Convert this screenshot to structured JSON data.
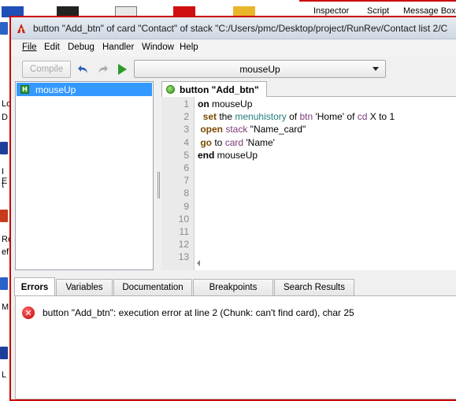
{
  "desktop": {
    "inspector_label": "Inspector",
    "script_label": "Script",
    "message_box_label": "Message Box",
    "left_icon_texts": [
      "Lo",
      "D",
      "I E",
      "t",
      "Re",
      "ef",
      "M",
      "L"
    ]
  },
  "window": {
    "title": "button \"Add_btn\" of card \"Contact\" of stack \"C:/Users/pmc/Desktop/project/RunRev/Contact list 2/C"
  },
  "menubar": {
    "items": [
      "File",
      "Edit",
      "Debug",
      "Handler",
      "Window",
      "Help"
    ]
  },
  "toolbar": {
    "compile_label": "Compile",
    "handler_selected": "mouseUp"
  },
  "handlers": {
    "items": [
      {
        "label": "mouseUp",
        "badge": "H"
      }
    ]
  },
  "editor": {
    "tab_label": "button \"Add_btn\"",
    "line_numbers": [
      "1",
      "2",
      "3",
      "4",
      "5",
      "6",
      "7",
      "8",
      "9",
      "10",
      "11",
      "12",
      "13"
    ],
    "lines": [
      {
        "segments": [
          {
            "t": "on",
            "c": "kw"
          },
          {
            "t": " mouseUp",
            "c": "plain"
          }
        ]
      },
      {
        "segments": [
          {
            "t": "  set",
            "c": "cmd"
          },
          {
            "t": " the ",
            "c": "plain"
          },
          {
            "t": "menuhistory",
            "c": "prop"
          },
          {
            "t": " of ",
            "c": "plain"
          },
          {
            "t": "btn",
            "c": "obj"
          },
          {
            "t": " 'Home' ",
            "c": "plain"
          },
          {
            "t": "of",
            "c": "plain"
          },
          {
            "t": " cd",
            "c": "obj"
          },
          {
            "t": " X ",
            "c": "plain"
          },
          {
            "t": "to",
            "c": "plain"
          },
          {
            "t": " 1",
            "c": "plain"
          }
        ]
      },
      {
        "segments": [
          {
            "t": " open",
            "c": "cmd"
          },
          {
            "t": " stack",
            "c": "obj"
          },
          {
            "t": " \"Name_card\"",
            "c": "plain"
          }
        ]
      },
      {
        "segments": [
          {
            "t": " go",
            "c": "cmd"
          },
          {
            "t": " to ",
            "c": "plain"
          },
          {
            "t": "card",
            "c": "obj"
          },
          {
            "t": " 'Name'",
            "c": "plain"
          }
        ]
      },
      {
        "segments": [
          {
            "t": "end",
            "c": "kw"
          },
          {
            "t": " mouseUp",
            "c": "plain"
          }
        ]
      }
    ]
  },
  "bottom": {
    "tabs": [
      "Errors",
      "Variables",
      "Documentation",
      "Breakpoints",
      "Search Results"
    ],
    "active_tab": "Errors",
    "error_message": "button \"Add_btn\": execution error at line 2 (Chunk: can't find card), char 25"
  }
}
